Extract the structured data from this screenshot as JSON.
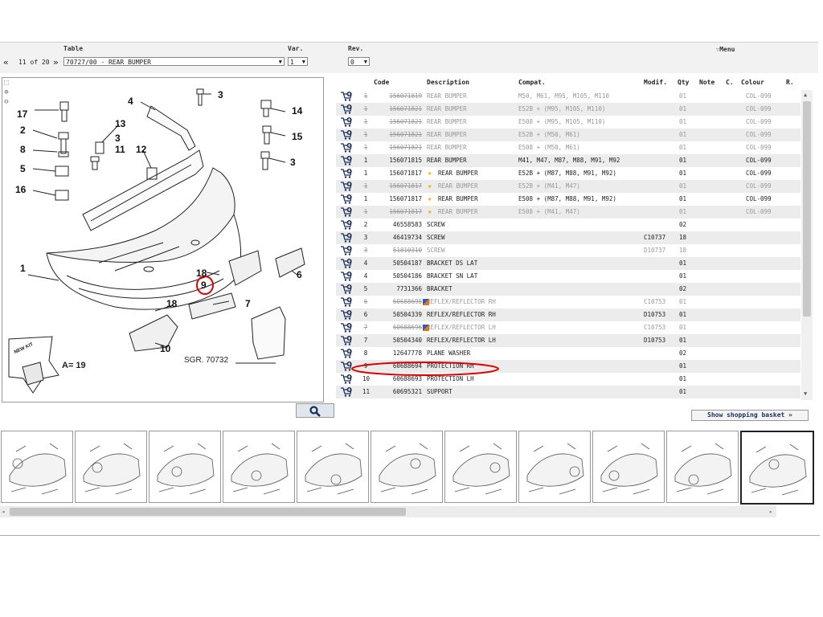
{
  "header": {
    "table_label": "Table",
    "var_label": "Var.",
    "rev_label": "Rev.",
    "menu_label": "Menu",
    "pager": {
      "prev": "«",
      "position": "11 of 20",
      "next": "»"
    },
    "table_value": "70727/00 - REAR BUMPER",
    "var_value": "1",
    "rev_value": "0"
  },
  "diagram": {
    "code": "SGR. 70732",
    "kit_text": "NEW KIT",
    "kit_formula": "A= 19",
    "callouts": [
      "1",
      "2",
      "3",
      "3",
      "3",
      "4",
      "5",
      "6",
      "7",
      "8",
      "9",
      "10",
      "11",
      "12",
      "13",
      "14",
      "15",
      "16",
      "17",
      "18",
      "18"
    ]
  },
  "columns": {
    "code": "Code",
    "description": "Description",
    "compat": "Compat.",
    "modif": "Modif.",
    "qty": "Qty",
    "note": "Note",
    "c": "C.",
    "colour": "Colour",
    "r": "R."
  },
  "rows": [
    {
      "n": "1",
      "code": "156071819",
      "desc": "REAR BUMPER",
      "compat": "M50, M61, M95, M105, M110",
      "modif": "",
      "qty": "01",
      "colour": "COL-099",
      "old": true,
      "star": false,
      "flag": false
    },
    {
      "n": "1",
      "code": "156071821",
      "desc": "REAR BUMPER",
      "compat": "E52B + (M95, M105, M110)",
      "modif": "",
      "qty": "01",
      "colour": "COL-099",
      "old": true,
      "star": false,
      "flag": false
    },
    {
      "n": "1",
      "code": "156071821",
      "desc": "REAR BUMPER",
      "compat": "E508 + (M95, M105, M110)",
      "modif": "",
      "qty": "01",
      "colour": "COL-099",
      "old": true,
      "star": false,
      "flag": false
    },
    {
      "n": "1",
      "code": "156071821",
      "desc": "REAR BUMPER",
      "compat": "E52B + (M50, M61)",
      "modif": "",
      "qty": "01",
      "colour": "COL-099",
      "old": true,
      "star": false,
      "flag": false
    },
    {
      "n": "1",
      "code": "156071821",
      "desc": "REAR BUMPER",
      "compat": "E508 + (M50, M61)",
      "modif": "",
      "qty": "01",
      "colour": "COL-099",
      "old": true,
      "star": false,
      "flag": false
    },
    {
      "n": "1",
      "code": "156071815",
      "desc": "REAR BUMPER",
      "compat": "M41, M47, M87, M88, M91, M92",
      "modif": "",
      "qty": "01",
      "colour": "COL-099",
      "old": false,
      "star": false,
      "flag": false
    },
    {
      "n": "1",
      "code": "156071817",
      "desc": "REAR BUMPER",
      "compat": "E52B + (M87, M88, M91, M92)",
      "modif": "",
      "qty": "01",
      "colour": "COL-099",
      "old": false,
      "star": true,
      "flag": false
    },
    {
      "n": "1",
      "code": "156071817",
      "desc": "REAR BUMPER",
      "compat": "E52B + (M41, M47)",
      "modif": "",
      "qty": "01",
      "colour": "COL-099",
      "old": true,
      "star": true,
      "flag": false
    },
    {
      "n": "1",
      "code": "156071817",
      "desc": "REAR BUMPER",
      "compat": "E508 + (M87, M88, M91, M92)",
      "modif": "",
      "qty": "01",
      "colour": "COL-099",
      "old": false,
      "star": true,
      "flag": false
    },
    {
      "n": "1",
      "code": "156071817",
      "desc": "REAR BUMPER",
      "compat": "E508 + (M41, M47)",
      "modif": "",
      "qty": "01",
      "colour": "COL-099",
      "old": true,
      "star": true,
      "flag": false
    },
    {
      "n": "2",
      "code": "46558583",
      "desc": "SCREW",
      "compat": "",
      "modif": "",
      "qty": "02",
      "colour": "",
      "old": false,
      "star": false,
      "flag": false
    },
    {
      "n": "3",
      "code": "46419734",
      "desc": "SCREW",
      "compat": "",
      "modif": "C10737",
      "qty": "18",
      "colour": "",
      "old": false,
      "star": false,
      "flag": false
    },
    {
      "n": "3",
      "code": "51810310",
      "desc": "SCREW",
      "compat": "",
      "modif": "D10737",
      "qty": "18",
      "colour": "",
      "old": true,
      "star": false,
      "flag": false
    },
    {
      "n": "4",
      "code": "50504187",
      "desc": "BRACKET DS LAT",
      "compat": "",
      "modif": "",
      "qty": "01",
      "colour": "",
      "old": false,
      "star": false,
      "flag": false
    },
    {
      "n": "4",
      "code": "50504186",
      "desc": "BRACKET SN LAT",
      "compat": "",
      "modif": "",
      "qty": "01",
      "colour": "",
      "old": false,
      "star": false,
      "flag": false
    },
    {
      "n": "5",
      "code": "7731366",
      "desc": "BRACKET",
      "compat": "",
      "modif": "",
      "qty": "02",
      "colour": "",
      "old": false,
      "star": false,
      "flag": false
    },
    {
      "n": "6",
      "code": "60688695",
      "desc": "REFLEX/REFLECTOR RH",
      "compat": "",
      "modif": "C10753",
      "qty": "01",
      "colour": "",
      "old": true,
      "star": false,
      "flag": true
    },
    {
      "n": "6",
      "code": "50504339",
      "desc": "REFLEX/REFLECTOR RH",
      "compat": "",
      "modif": "D10753",
      "qty": "01",
      "colour": "",
      "old": false,
      "star": false,
      "flag": false
    },
    {
      "n": "7",
      "code": "60688696",
      "desc": "REFLEX/REFLECTOR LH",
      "compat": "",
      "modif": "C10753",
      "qty": "01",
      "colour": "",
      "old": true,
      "star": false,
      "flag": true
    },
    {
      "n": "7",
      "code": "50504340",
      "desc": "REFLEX/REFLECTOR LH",
      "compat": "",
      "modif": "D10753",
      "qty": "01",
      "colour": "",
      "old": false,
      "star": false,
      "flag": false
    },
    {
      "n": "8",
      "code": "12647778",
      "desc": "PLANE WASHER",
      "compat": "",
      "modif": "",
      "qty": "02",
      "colour": "",
      "old": false,
      "star": false,
      "flag": false
    },
    {
      "n": "9",
      "code": "60688694",
      "desc": "PROTECTION RH",
      "compat": "",
      "modif": "",
      "qty": "01",
      "colour": "",
      "old": false,
      "star": false,
      "flag": false
    },
    {
      "n": "10",
      "code": "60688693",
      "desc": "PROTECTION LH",
      "compat": "",
      "modif": "",
      "qty": "01",
      "colour": "",
      "old": false,
      "star": false,
      "flag": false
    },
    {
      "n": "11",
      "code": "60695321",
      "desc": "SUPPORT",
      "compat": "",
      "modif": "",
      "qty": "01",
      "colour": "",
      "old": false,
      "star": false,
      "flag": false
    }
  ],
  "buttons": {
    "basket": "Show shopping basket »"
  },
  "thumbnail_count": 11,
  "active_thumbnail": 11,
  "highlight_color": "#e00000",
  "star_color": "#f0b400"
}
